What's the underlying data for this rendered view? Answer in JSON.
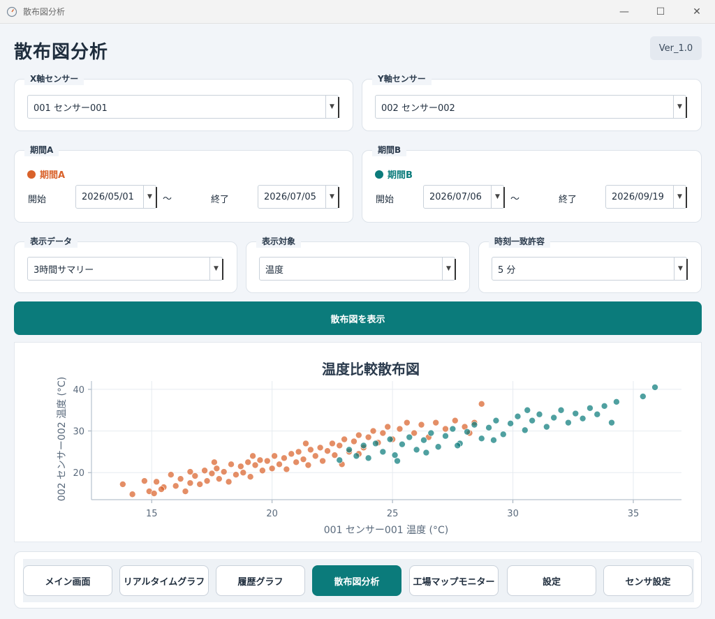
{
  "window": {
    "title": "散布図分析"
  },
  "header": {
    "title": "散布図分析",
    "version": "Ver_1.0"
  },
  "x_sensor": {
    "label": "X軸センサー",
    "value": "001 センサー001"
  },
  "y_sensor": {
    "label": "Y軸センサー",
    "value": "002 センサー002"
  },
  "period_a": {
    "label": "期間A",
    "title": "期間A",
    "start_label": "開始",
    "end_label": "終了",
    "start": "2026/05/01",
    "end": "2026/07/05",
    "separator": "〜",
    "color": "#d9622b"
  },
  "period_b": {
    "label": "期間B",
    "title": "期間B",
    "start_label": "開始",
    "end_label": "終了",
    "start": "2026/07/06",
    "end": "2026/09/19",
    "separator": "〜",
    "color": "#0b7b7b"
  },
  "display_data": {
    "label": "表示データ",
    "value": "3時間サマリー"
  },
  "display_target": {
    "label": "表示対象",
    "value": "温度"
  },
  "tolerance": {
    "label": "時刻一致許容",
    "value": "5 分"
  },
  "actions": {
    "show_scatter": "散布図を表示"
  },
  "chart_data": {
    "type": "scatter",
    "title": "温度比較散布図",
    "xlabel": "001 センサー001 温度 (°C)",
    "ylabel": "002 センサー002 温度 (°C)",
    "xlim": [
      12.5,
      37
    ],
    "ylim": [
      13.5,
      42
    ],
    "xticks": [
      15,
      20,
      25,
      30,
      35
    ],
    "yticks": [
      20,
      30,
      40
    ],
    "grid": true,
    "series": [
      {
        "color": "#d9622b",
        "points": [
          [
            13.8,
            17.2
          ],
          [
            14.2,
            14.8
          ],
          [
            14.7,
            18
          ],
          [
            14.9,
            15.5
          ],
          [
            15.1,
            15
          ],
          [
            15.2,
            17.8
          ],
          [
            15.5,
            16.5
          ],
          [
            15.8,
            19.5
          ],
          [
            16,
            16.8
          ],
          [
            16.2,
            18.5
          ],
          [
            16.4,
            15.5
          ],
          [
            16.6,
            17.5
          ],
          [
            16.8,
            19.2
          ],
          [
            17,
            17.2
          ],
          [
            17.2,
            20.5
          ],
          [
            17.3,
            18
          ],
          [
            17.5,
            19.8
          ],
          [
            17.7,
            21
          ],
          [
            17.8,
            18.5
          ],
          [
            18,
            20.2
          ],
          [
            18.2,
            17.8
          ],
          [
            18.3,
            22
          ],
          [
            18.5,
            19.5
          ],
          [
            18.7,
            21.5
          ],
          [
            18.8,
            20
          ],
          [
            19,
            22.5
          ],
          [
            19.1,
            19
          ],
          [
            19.3,
            21.8
          ],
          [
            19.5,
            23
          ],
          [
            19.6,
            20.5
          ],
          [
            19.8,
            22.8
          ],
          [
            20,
            21
          ],
          [
            20.1,
            24
          ],
          [
            20.3,
            22
          ],
          [
            20.5,
            23.5
          ],
          [
            20.6,
            20.8
          ],
          [
            20.8,
            24.5
          ],
          [
            21,
            22.5
          ],
          [
            21.1,
            25
          ],
          [
            21.3,
            23.2
          ],
          [
            21.5,
            21.8
          ],
          [
            21.6,
            25.5
          ],
          [
            21.8,
            24
          ],
          [
            22,
            26
          ],
          [
            22.1,
            22.8
          ],
          [
            22.3,
            25.2
          ],
          [
            22.5,
            27
          ],
          [
            22.6,
            24.2
          ],
          [
            22.8,
            26.5
          ],
          [
            23,
            28
          ],
          [
            23.2,
            25
          ],
          [
            23.4,
            27.5
          ],
          [
            23.6,
            29
          ],
          [
            23.8,
            26
          ],
          [
            24,
            28.5
          ],
          [
            24.2,
            30
          ],
          [
            24.4,
            27.2
          ],
          [
            24.6,
            29.5
          ],
          [
            24.8,
            31
          ],
          [
            25,
            28
          ],
          [
            25.3,
            30.5
          ],
          [
            25.6,
            32
          ],
          [
            25.9,
            29.5
          ],
          [
            26.2,
            31.5
          ],
          [
            26.5,
            28.5
          ],
          [
            26.8,
            32
          ],
          [
            27.2,
            30.5
          ],
          [
            27.6,
            32.5
          ],
          [
            28,
            31
          ],
          [
            28.4,
            32
          ],
          [
            28.7,
            36.5
          ],
          [
            28.2,
            29.5
          ],
          [
            22.9,
            22
          ],
          [
            23.6,
            24.5
          ],
          [
            21.4,
            27
          ],
          [
            19.2,
            24
          ],
          [
            17.6,
            22.5
          ],
          [
            16.6,
            20.2
          ],
          [
            15.4,
            16
          ]
        ]
      },
      {
        "color": "#0b7b7b",
        "points": [
          [
            22.8,
            23
          ],
          [
            23.2,
            25.5
          ],
          [
            23.5,
            24
          ],
          [
            23.8,
            26.5
          ],
          [
            24,
            23.5
          ],
          [
            24.3,
            27
          ],
          [
            24.6,
            25
          ],
          [
            24.9,
            28
          ],
          [
            25.1,
            24.2
          ],
          [
            25.4,
            26.8
          ],
          [
            25.7,
            28.5
          ],
          [
            26,
            25.5
          ],
          [
            26.3,
            27.8
          ],
          [
            26.6,
            29.5
          ],
          [
            26.9,
            26.2
          ],
          [
            27.2,
            28.8
          ],
          [
            27.5,
            30.5
          ],
          [
            27.8,
            27
          ],
          [
            28.1,
            29.8
          ],
          [
            28.4,
            31.5
          ],
          [
            28.7,
            28.2
          ],
          [
            29,
            30.8
          ],
          [
            29.3,
            32.5
          ],
          [
            29.6,
            29.2
          ],
          [
            29.9,
            31.8
          ],
          [
            30.2,
            33.5
          ],
          [
            30.5,
            30.2
          ],
          [
            30.8,
            32.5
          ],
          [
            31.1,
            34
          ],
          [
            31.4,
            31
          ],
          [
            31.7,
            33.2
          ],
          [
            32,
            35
          ],
          [
            32.3,
            32
          ],
          [
            32.6,
            34.2
          ],
          [
            32.9,
            33
          ],
          [
            33.2,
            35.5
          ],
          [
            33.5,
            34
          ],
          [
            33.8,
            36
          ],
          [
            34.1,
            32
          ],
          [
            34.3,
            37
          ],
          [
            35.4,
            38.3
          ],
          [
            35.9,
            40.5
          ],
          [
            30.6,
            35
          ],
          [
            29.2,
            27.8
          ],
          [
            27.7,
            26.5
          ],
          [
            26.4,
            24.8
          ],
          [
            25.2,
            22.8
          ]
        ]
      }
    ]
  },
  "nav": {
    "items": [
      {
        "label": "メイン画面"
      },
      {
        "label": "リアルタイムグラフ"
      },
      {
        "label": "履歴グラフ"
      },
      {
        "label": "散布図分析"
      },
      {
        "label": "工場マップモニター"
      },
      {
        "label": "設定"
      },
      {
        "label": "センサ設定"
      }
    ]
  },
  "icons": {
    "app": "gauge-icon",
    "minimize": "minimize-icon",
    "maximize": "maximize-icon",
    "close": "close-icon",
    "dropdown": "chevron-down-icon"
  }
}
